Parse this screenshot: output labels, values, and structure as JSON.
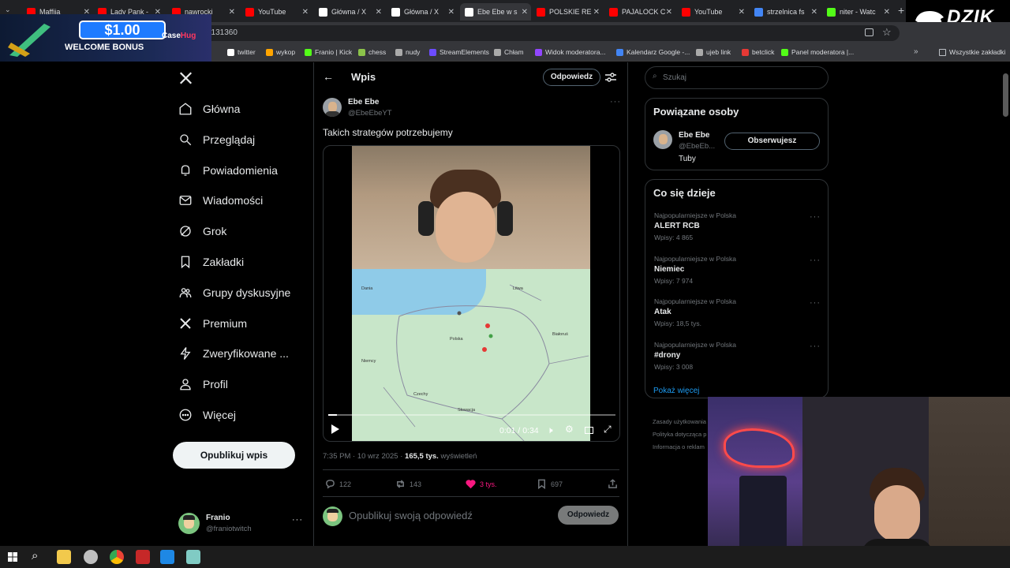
{
  "browser": {
    "tabs": [
      {
        "label": "Maffija",
        "color": "#ff0000"
      },
      {
        "label": "Lady Pank - ",
        "color": "#ff0000"
      },
      {
        "label": "nawrocki",
        "color": "#ff0000"
      },
      {
        "label": "YouTube",
        "color": "#ff0000"
      },
      {
        "label": "Główna / X",
        "color": "#ffffff"
      },
      {
        "label": "Główna / X",
        "color": "#ffffff"
      },
      {
        "label": "Ebe Ebe w s",
        "color": "#ffffff"
      },
      {
        "label": "POLSKIE RE",
        "color": "#ff0000"
      },
      {
        "label": "PAJALOCK C",
        "color": "#ff0000"
      },
      {
        "label": "YouTube",
        "color": "#ff0000"
      },
      {
        "label": "strzelnica fs",
        "color": "#4285f4"
      },
      {
        "label": "niter - Watc",
        "color": "#53fc18"
      }
    ],
    "url_fragment": "5131360",
    "bookmarks": [
      {
        "label": "twitter",
        "color": "#ffffff"
      },
      {
        "label": "wykop",
        "color": "#ffa500"
      },
      {
        "label": "Franio | Kick",
        "color": "#53fc18"
      },
      {
        "label": "chess",
        "color": "#8bc34a"
      },
      {
        "label": "nudy",
        "color": "#aaaaaa"
      },
      {
        "label": "StreamElements",
        "color": "#6c4cff"
      },
      {
        "label": "Chłam",
        "color": "#aaaaaa"
      },
      {
        "label": "Widok moderatora...",
        "color": "#9146ff"
      },
      {
        "label": "Kalendarz Google -...",
        "color": "#4285f4"
      },
      {
        "label": "ujeb link",
        "color": "#aaaaaa"
      },
      {
        "label": "betclick",
        "color": "#e53935"
      },
      {
        "label": "Panel moderatora |...",
        "color": "#53fc18"
      }
    ],
    "all_bookmarks": "Wszystkie zakładki"
  },
  "ad": {
    "amount": "$1.00",
    "welcome": "WELCOME BONUS",
    "brand_a": "Case",
    "brand_b": "Hug"
  },
  "overlay_brand": "DZIK",
  "nav": {
    "items": [
      "Główna",
      "Przeglądaj",
      "Powiadomienia",
      "Wiadomości",
      "Grok",
      "Zakładki",
      "Grupy dyskusyjne",
      "Premium",
      "Zweryfikowane ...",
      "Profil",
      "Więcej"
    ],
    "post_button": "Opublikuj wpis",
    "user_name": "Franio",
    "user_handle": "@franiotwitch"
  },
  "post": {
    "header_title": "Wpis",
    "reply_button": "Odpowiedz",
    "author_name": "Ebe Ebe",
    "author_handle": "@EbeEbeYT",
    "text": "Takich strategów potrzebujemy",
    "video_time": "0:01 / 0:34",
    "video_progress": 0.03,
    "timestamp": "7:35 PM · 10 wrz 2025 · ",
    "views_count": "165,5 tys.",
    "views_label": " wyświetleń",
    "replies": "122",
    "reposts": "143",
    "likes": "3 tys.",
    "bookmarks": "697",
    "reply_placeholder": "Opublikuj swoją odpowiedź",
    "reply_submit": "Odpowiedz",
    "map_labels": [
      "Dania",
      "Litwa",
      "Polska",
      "Białoruś",
      "Czechy",
      "Słowacja",
      "Niemcy"
    ]
  },
  "sidebar": {
    "search_placeholder": "Szukaj",
    "related_title": "Powiązane osoby",
    "related_name": "Ebe Ebe",
    "related_handle": "@EbeEb...",
    "related_bio": "Tuby",
    "follow_button": "Obserwujesz",
    "trends_title": "Co się dzieje",
    "trends": [
      {
        "category": "Najpopularniejsze w Polska",
        "name": "ALERT RCB",
        "count": "Wpisy: 4 865"
      },
      {
        "category": "Najpopularniejsze w Polska",
        "name": "Niemiec",
        "count": "Wpisy: 7 974"
      },
      {
        "category": "Najpopularniejsze w Polska",
        "name": "Atak",
        "count": "Wpisy: 18,5 tys."
      },
      {
        "category": "Najpopularniejsze w Polska",
        "name": "#drony",
        "count": "Wpisy: 3 008"
      }
    ],
    "show_more": "Pokaż więcej",
    "footer": [
      "Zasady użytkowania",
      "Polityka dotycząca p",
      "Informacja o reklam"
    ]
  },
  "colors": {
    "accent": "#1d9bf0",
    "like": "#f91880",
    "background": "#000000",
    "border": "#2f3336"
  }
}
